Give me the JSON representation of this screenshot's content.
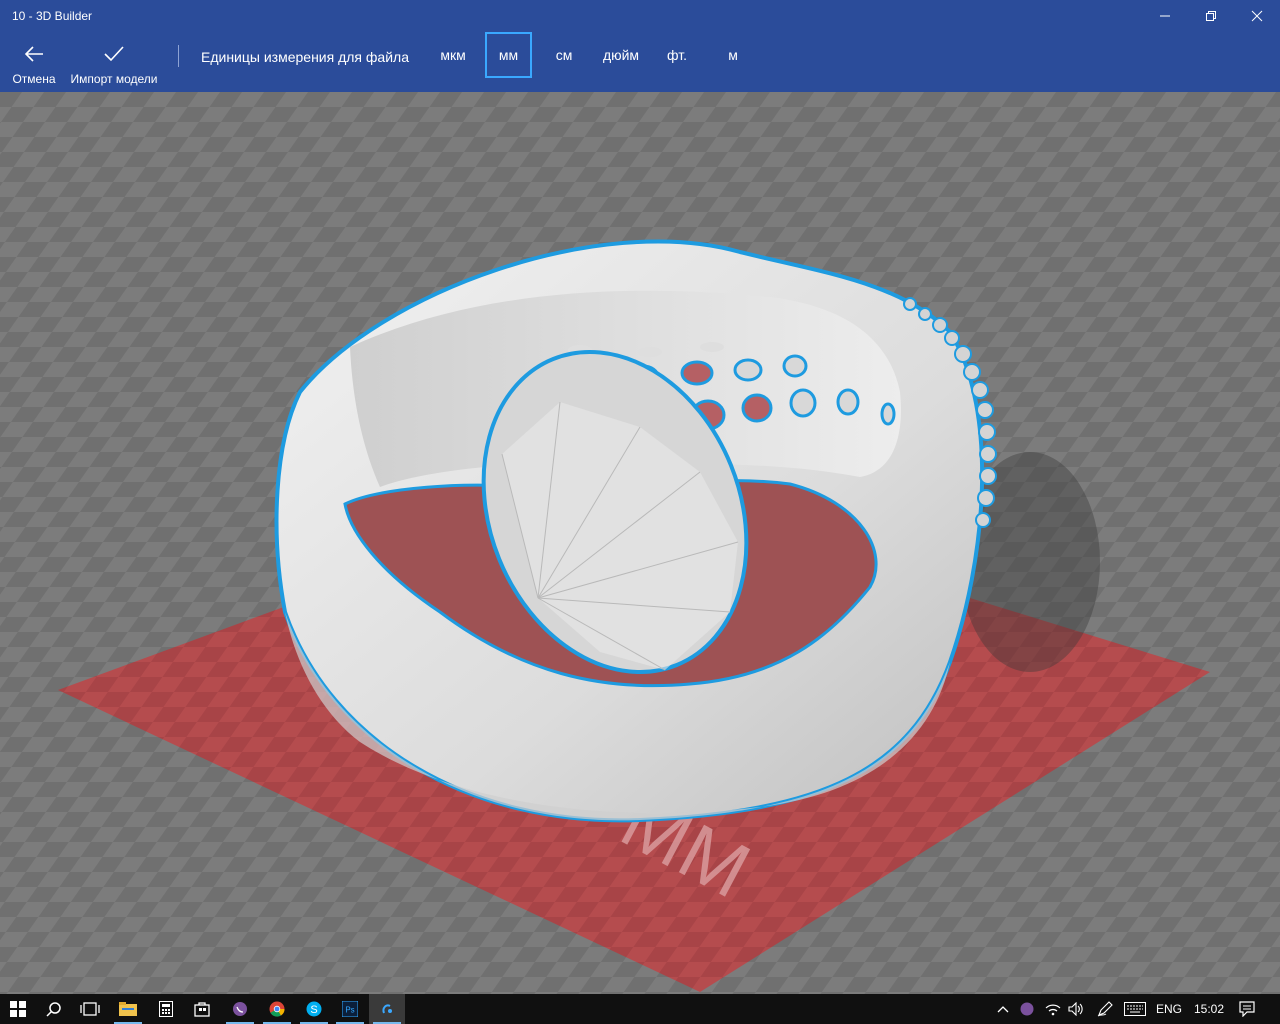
{
  "window": {
    "title": "10 - 3D Builder",
    "controls": [
      "minimize-icon",
      "restore-icon",
      "close-icon"
    ]
  },
  "commandbar": {
    "cancel_label": "Отмена",
    "import_label": "Импорт модели",
    "units_label": "Единицы измерения для файла",
    "units": [
      {
        "label": "мкм",
        "selected": false
      },
      {
        "label": "мм",
        "selected": true
      },
      {
        "label": "см",
        "selected": false
      },
      {
        "label": "дюйм",
        "selected": false
      },
      {
        "label": "фт.",
        "selected": false
      },
      {
        "label": "м",
        "selected": false
      }
    ]
  },
  "viewport": {
    "plate_unit_watermark": "MM",
    "colors": {
      "background": "#7a7a7a",
      "build_plate": "#b5474a",
      "model": "#e6e6e6",
      "selection_outline": "#1e9be0"
    }
  },
  "taskbar": {
    "apps": [
      "windows-start-icon",
      "search-icon",
      "task-view-icon",
      "file-explorer-icon",
      "calculator-icon",
      "store-icon",
      "viber-icon",
      "chrome-icon",
      "skype-icon",
      "photoshop-icon",
      "3d-builder-icon"
    ],
    "language": "ENG",
    "time": "15:02"
  },
  "accent": "#2b4c9a"
}
